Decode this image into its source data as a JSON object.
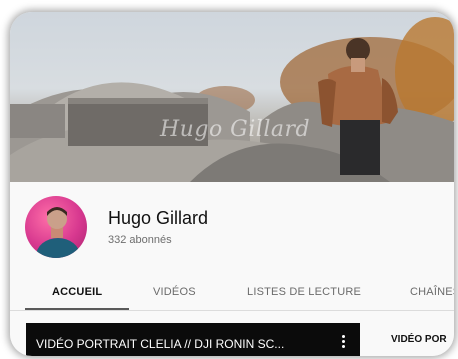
{
  "banner": {
    "watermark": "Hugo Gillard"
  },
  "channel": {
    "name": "Hugo Gillard",
    "subscribers": "332 abonnés"
  },
  "tabs": [
    {
      "label": "ACCUEIL",
      "active": true
    },
    {
      "label": "VIDÉOS",
      "active": false
    },
    {
      "label": "LISTES DE LECTURE",
      "active": false
    },
    {
      "label": "CHAÎNES",
      "active": false
    }
  ],
  "featured_video": {
    "title": "VIDÉO PORTRAIT CLELIA // DJI RONIN SC...",
    "menu_icon": "more-vert-icon"
  },
  "side_video": {
    "title": "VIDÉO POR"
  },
  "colors": {
    "accent_underline": "#5a5a5a",
    "video_bg": "#0b0b0b",
    "avatar_pink": "#d7388f"
  }
}
